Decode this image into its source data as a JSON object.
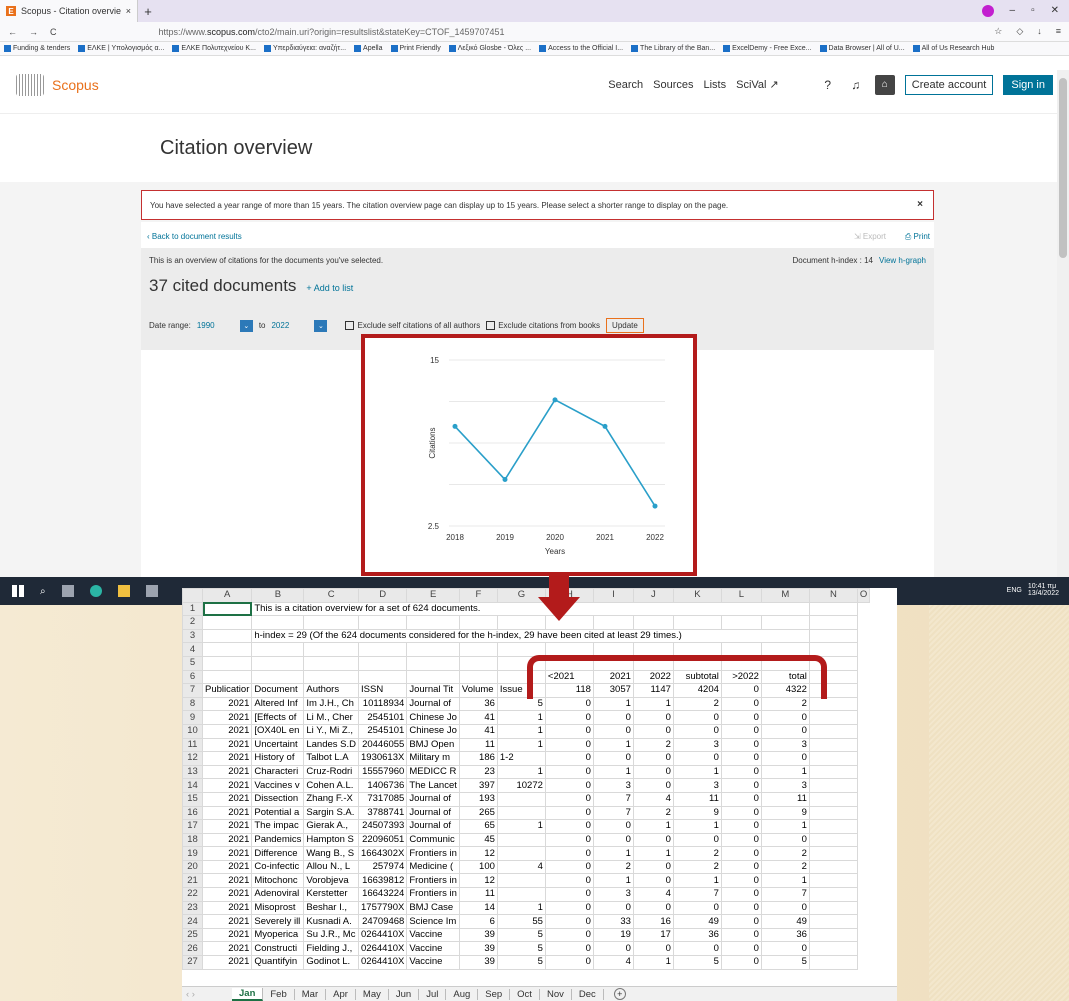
{
  "browser": {
    "tab_title": "Scopus - Citation overview",
    "url_prefix": "https://www.",
    "url_domain": "scopus.com",
    "url_rest": "/cto2/main.uri?origin=resultslist&stateKey=CTOF_1459707451",
    "bookmarks": [
      "Funding & tenders",
      "ΕΛΚΕ | Υπολογισμός α...",
      "ΕΛΚΕ Πολυτεχνείου Κ...",
      "Υπερδιαύγεια: αναζήτ...",
      "Apella",
      "Print Friendly",
      "Λεξικό Glosbe - Όλες ...",
      "Access to the Official I...",
      "The Library of the Ban...",
      "ExcelDemy - Free Exce...",
      "Data Browser | All of U...",
      "All of Us Research Hub"
    ]
  },
  "scopus": {
    "logo": "Scopus",
    "nav": [
      "Search",
      "Sources",
      "Lists",
      "SciVal ↗"
    ],
    "create_account": "Create account",
    "sign_in": "Sign in",
    "page_title": "Citation overview",
    "alert": "You have selected a year range of more than 15 years. The citation overview page can display up to 15 years. Please select a shorter range to display on the page.",
    "back": "Back to document results",
    "export": "Export",
    "print": "Print",
    "intro": "This is an overview of citations for the documents you've selected.",
    "h_index_label": "Document h-index : 14",
    "h_graph": "View h-graph",
    "cited_count": "37 cited documents",
    "add_to_list": "Add to list",
    "date_range_label": "Date range:",
    "date_from": "1990",
    "to_label": "to",
    "date_to": "2022",
    "exclude_self": "Exclude self citations of all authors",
    "exclude_books": "Exclude citations from books",
    "update": "Update"
  },
  "chart_data": {
    "type": "line",
    "x": [
      2018,
      2019,
      2020,
      2021,
      2022
    ],
    "values": [
      10,
      6,
      12,
      10,
      4
    ],
    "ylabel": "Citations",
    "xlabel": "Years",
    "y_ticks": [
      "15",
      "2.5"
    ],
    "ylim": [
      2.5,
      15
    ],
    "color": "#2a9fc9"
  },
  "taskbar": {
    "lang": "ENG",
    "time": "10:41 πμ",
    "date": "13/4/2022"
  },
  "sheet": {
    "columns": [
      "A",
      "B",
      "C",
      "D",
      "E",
      "F",
      "G",
      "H",
      "I",
      "J",
      "K",
      "L",
      "M",
      "N",
      "O"
    ],
    "rows": [
      [
        "1",
        "",
        "This is a citation overview for a set of 624 documents.",
        "",
        "",
        "",
        "",
        "",
        "",
        "",
        "",
        "",
        "",
        "",
        ""
      ],
      [
        "2",
        "",
        "",
        "",
        "",
        "",
        "",
        "",
        "",
        "",
        "",
        "",
        "",
        "",
        ""
      ],
      [
        "3",
        "",
        "h-index = 29 (Of the 624 documents considered for the h-index, 29 have been cited at least 29 times.)",
        "",
        "",
        "",
        "",
        "",
        "",
        "",
        "",
        "",
        "",
        "",
        ""
      ],
      [
        "4",
        "",
        "",
        "",
        "",
        "",
        "",
        "",
        "",
        "",
        "",
        "",
        "",
        "",
        ""
      ],
      [
        "5",
        "",
        "",
        "",
        "",
        "",
        "",
        "",
        "",
        "",
        "",
        "",
        "",
        "",
        ""
      ],
      [
        "6",
        "",
        "",
        "",
        "",
        "",
        "",
        "",
        "<2021",
        "2021",
        "2022",
        "subtotal",
        ">2022",
        "total",
        ""
      ],
      [
        "7",
        "Publicatior",
        "Document",
        "Authors",
        "ISSN",
        "Journal Tit",
        "Volume",
        "Issue",
        "118",
        "3057",
        "1147",
        "4204",
        "0",
        "4322",
        ""
      ],
      [
        "8",
        "2021",
        "Altered Inf",
        "Im J.H., Ch",
        "10118934",
        "Journal of",
        "36",
        "5",
        "0",
        "1",
        "1",
        "2",
        "0",
        "2",
        ""
      ],
      [
        "9",
        "2021",
        "[Effects of",
        "Li M., Cher",
        "2545101",
        "Chinese Jo",
        "41",
        "1",
        "0",
        "0",
        "0",
        "0",
        "0",
        "0",
        ""
      ],
      [
        "10",
        "2021",
        "[OX40L en",
        "Li Y., Mi Z.,",
        "2545101",
        "Chinese Jo",
        "41",
        "1",
        "0",
        "0",
        "0",
        "0",
        "0",
        "0",
        ""
      ],
      [
        "11",
        "2021",
        "Uncertaint",
        "Landes S.D",
        "20446055",
        "BMJ Open",
        "11",
        "1",
        "0",
        "1",
        "2",
        "3",
        "0",
        "3",
        ""
      ],
      [
        "12",
        "2021",
        "History of",
        "Talbot L.A",
        "1930613X",
        "Military m",
        "186",
        "1-2",
        "0",
        "0",
        "0",
        "0",
        "0",
        "0",
        ""
      ],
      [
        "13",
        "2021",
        "Characteri",
        "Cruz-Rodri",
        "15557960",
        "MEDICC R",
        "23",
        "1",
        "0",
        "1",
        "0",
        "1",
        "0",
        "1",
        ""
      ],
      [
        "14",
        "2021",
        "Vaccines v",
        "Cohen A.L.",
        "1406736",
        "The Lancet",
        "397",
        "10272",
        "0",
        "3",
        "0",
        "3",
        "0",
        "3",
        ""
      ],
      [
        "15",
        "2021",
        "Dissection",
        "Zhang F.-X",
        "7317085",
        "Journal of",
        "193",
        "",
        "0",
        "7",
        "4",
        "11",
        "0",
        "11",
        ""
      ],
      [
        "16",
        "2021",
        "Potential a",
        "Sargin S.A.",
        "3788741",
        "Journal of",
        "265",
        "",
        "0",
        "7",
        "2",
        "9",
        "0",
        "9",
        ""
      ],
      [
        "17",
        "2021",
        "The impac",
        "Gierak A.,",
        "24507393",
        "Journal of",
        "65",
        "1",
        "0",
        "0",
        "1",
        "1",
        "0",
        "1",
        ""
      ],
      [
        "18",
        "2021",
        "Pandemics",
        "Hampton S",
        "22096051",
        "Communic",
        "45",
        "",
        "0",
        "0",
        "0",
        "0",
        "0",
        "0",
        ""
      ],
      [
        "19",
        "2021",
        "Difference",
        "Wang B., S",
        "1664302X",
        "Frontiers in",
        "12",
        "",
        "0",
        "1",
        "1",
        "2",
        "0",
        "2",
        ""
      ],
      [
        "20",
        "2021",
        "Co-infectic",
        "Allou N., L",
        "257974",
        "Medicine (",
        "100",
        "4",
        "0",
        "2",
        "0",
        "2",
        "0",
        "2",
        ""
      ],
      [
        "21",
        "2021",
        "Mitochonc",
        "Vorobjeva",
        "16639812",
        "Frontiers in",
        "12",
        "",
        "0",
        "1",
        "0",
        "1",
        "0",
        "1",
        ""
      ],
      [
        "22",
        "2021",
        "Adenoviral",
        "Kerstetter",
        "16643224",
        "Frontiers in",
        "11",
        "",
        "0",
        "3",
        "4",
        "7",
        "0",
        "7",
        ""
      ],
      [
        "23",
        "2021",
        "Misoprost",
        "Beshar I.,",
        "1757790X",
        "BMJ Case",
        "14",
        "1",
        "0",
        "0",
        "0",
        "0",
        "0",
        "0",
        ""
      ],
      [
        "24",
        "2021",
        "Severely ill",
        "Kusnadi A.",
        "24709468",
        "Science Im",
        "6",
        "55",
        "0",
        "33",
        "16",
        "49",
        "0",
        "49",
        ""
      ],
      [
        "25",
        "2021",
        "Myoperica",
        "Su J.R., Mc",
        "0264410X",
        "Vaccine",
        "39",
        "5",
        "0",
        "19",
        "17",
        "36",
        "0",
        "36",
        ""
      ],
      [
        "26",
        "2021",
        "Constructi",
        "Fielding J.,",
        "0264410X",
        "Vaccine",
        "39",
        "5",
        "0",
        "0",
        "0",
        "0",
        "0",
        "0",
        ""
      ],
      [
        "27",
        "2021",
        "Quantifyin",
        "Godinot L.",
        "0264410X",
        "Vaccine",
        "39",
        "5",
        "0",
        "4",
        "1",
        "5",
        "0",
        "5",
        ""
      ]
    ],
    "tabs": [
      "Jan",
      "Feb",
      "Mar",
      "Apr",
      "May",
      "Jun",
      "Jul",
      "Aug",
      "Sep",
      "Oct",
      "Nov",
      "Dec"
    ],
    "active_tab": "Jan"
  }
}
